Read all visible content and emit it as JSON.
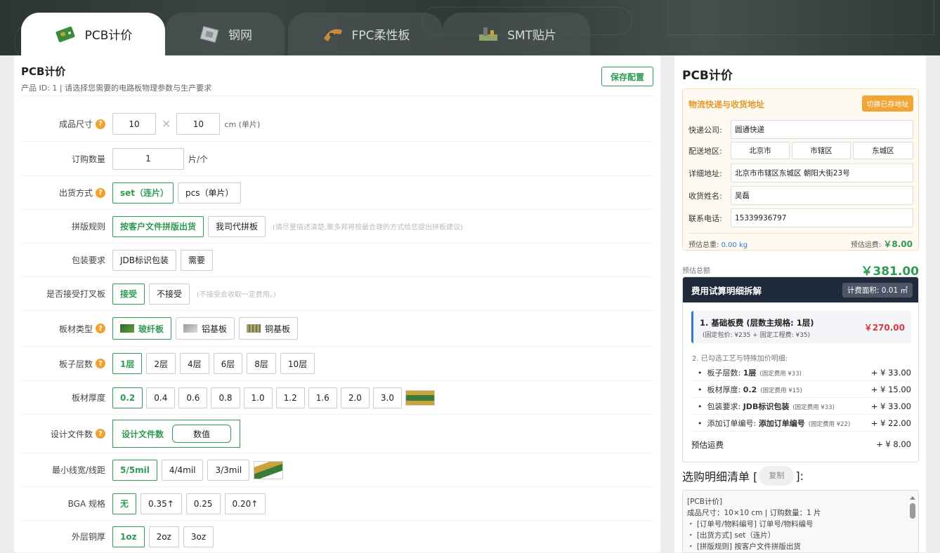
{
  "tabs": [
    {
      "label": "PCB计价",
      "icon": "pcb-board-icon",
      "active": true
    },
    {
      "label": "钢网",
      "icon": "stencil-icon",
      "active": false
    },
    {
      "label": "FPC柔性板",
      "icon": "fpc-icon",
      "active": false
    },
    {
      "label": "SMT贴片",
      "icon": "smt-icon",
      "active": false
    }
  ],
  "form": {
    "title": "PCB计价",
    "subtitle": "产品 ID: 1 | 请选择您需要的电路板物理参数与生产要求",
    "save_label": "保存配置",
    "size": {
      "label": "成品尺寸",
      "w": "10",
      "times": "✕",
      "h": "10",
      "unit": "cm (单片)"
    },
    "qty": {
      "label": "订购数量",
      "value": "1",
      "unit": "片/个"
    },
    "ship_mode": {
      "label": "出货方式",
      "options": [
        "set（连片）",
        "pcs（单片）"
      ]
    },
    "panel": {
      "label": "拼版规则",
      "options": [
        "按客户文件拼版出货",
        "我司代拼板"
      ],
      "hint": "(请尽量描述清楚,聚多邦将按最合理的方式给您提出拼板建议)"
    },
    "pack": {
      "label": "包装要求",
      "options": [
        "JDB标识包装",
        "需要"
      ]
    },
    "cross": {
      "label": "是否接受打叉板",
      "options": [
        "接受",
        "不接受"
      ],
      "hint": "(不接受会收取一定费用。)"
    },
    "material": {
      "label": "板材类型",
      "options": [
        "玻纤板",
        "铝基板",
        "铜基板"
      ]
    },
    "layers": {
      "label": "板子层数",
      "options": [
        "1层",
        "2层",
        "4层",
        "6层",
        "8层",
        "10层"
      ]
    },
    "thickness": {
      "label": "板材厚度",
      "options": [
        "0.2",
        "0.4",
        "0.6",
        "0.8",
        "1.0",
        "1.2",
        "1.6",
        "2.0",
        "3.0"
      ]
    },
    "design": {
      "label": "设计文件数",
      "a": "设计文件数",
      "b": "数值"
    },
    "trace": {
      "label": "最小线宽/线距",
      "options": [
        "5/5mil",
        "4/4mil",
        "3/3mil"
      ]
    },
    "bga": {
      "label": "BGA 规格",
      "options": [
        "无",
        "0.35↑",
        "0.25",
        "0.20↑"
      ]
    },
    "copper": {
      "label": "外层铜厚",
      "options": [
        "1oz",
        "2oz",
        "3oz"
      ]
    },
    "q": "?"
  },
  "summary": {
    "title": "PCB计价",
    "address": {
      "heading": "物流快递与收货地址",
      "switch_label": "切换已存地址",
      "courier_label": "快递公司:",
      "courier": "圆通快递",
      "region_label": "配送地区:",
      "province": "北京市",
      "city": "市辖区",
      "district": "东城区",
      "detail_label": "详细地址:",
      "detail": "北京市市辖区东城区 朝阳大街23号",
      "name_label": "收货姓名:",
      "name": "吴磊",
      "phone_label": "联系电话:",
      "phone": "15339936797",
      "weight_label": "预估总重:",
      "weight": "0.00 kg",
      "freight_label": "预估运费:",
      "freight": "￥8.00"
    },
    "total_label": "预估总额",
    "total": "￥381.00",
    "breakdown": {
      "title": "费用试算明细拆解",
      "area": "计费面积: 0.01 ㎡",
      "base_title": "1. 基础板费 (层数主规格: 1层)",
      "base_sub": "(固定包价: ¥235 + 固定工程费: ¥35)",
      "base_value": "￥270.00",
      "section2": "2. 已勾选工艺与特殊加价明细:",
      "items": [
        {
          "k": "板子层数:",
          "v": "1层",
          "fee": "(固定费用 ¥33)",
          "amt": "+ ¥ 33.00"
        },
        {
          "k": "板材厚度:",
          "v": "0.2",
          "fee": "(固定费用 ¥15)",
          "amt": "+ ¥ 15.00"
        },
        {
          "k": "包装要求:",
          "v": "JDB标识包装",
          "fee": "(固定费用 ¥33)",
          "amt": "+ ¥ 33.00"
        },
        {
          "k": "添加订单编号:",
          "v": "添加订单编号",
          "fee": "(固定费用 ¥22)",
          "amt": "+ ¥ 22.00"
        }
      ],
      "ship_label": "预估运费",
      "ship_value": "+ ¥ 8.00"
    },
    "list": {
      "title_a": "选购明细清单 [",
      "copy": "复制",
      "title_b": "]:",
      "lines": [
        "[PCB计价]",
        "成品尺寸：10×10 cm | 订购数量：1 片",
        "・ [订单号/物料编号] 订单号/物料编号",
        "・ [出货方式] set（连片）",
        "・ [拼版规则] 按客户文件拼版出货"
      ]
    }
  },
  "colors": {
    "accent": "#2f9a52",
    "orange": "#f0a535",
    "navy": "#1f2a3a",
    "red": "#d9363e"
  }
}
